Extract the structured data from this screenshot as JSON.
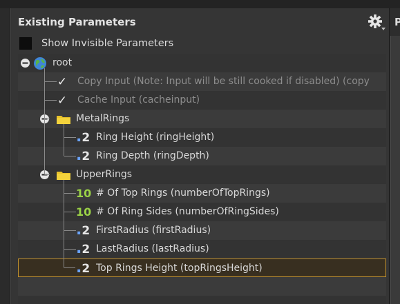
{
  "panel": {
    "title": "Existing Parameters",
    "gear_icon": "gear-menu-icon",
    "show_invisible": {
      "label": "Show Invisible Parameters",
      "checked": false
    }
  },
  "right_panel": {
    "title_fragment": "P"
  },
  "tree": {
    "root": {
      "label": "root",
      "icon": "globe-icon",
      "expanded": true
    },
    "items": [
      {
        "label": "Copy Input (Note: Input will be still cooked if disabled) (copy",
        "type": "toggle",
        "dimmed": true
      },
      {
        "label": "Cache Input (cacheinput)",
        "type": "toggle",
        "dimmed": true
      },
      {
        "label": "MetalRings",
        "type": "folder",
        "expanded": true
      },
      {
        "label": "Ring Height (ringHeight)",
        "type": "float"
      },
      {
        "label": "Ring Depth (ringDepth)",
        "type": "float"
      },
      {
        "label": "UpperRings",
        "type": "folder",
        "expanded": true
      },
      {
        "label": "# Of Top Rings (numberOfTopRings)",
        "type": "int",
        "glyph": "10"
      },
      {
        "label": "# Of Ring Sides (numberOfRingSides)",
        "type": "int",
        "glyph": "10"
      },
      {
        "label": "FirstRadius (firstRadius)",
        "type": "float"
      },
      {
        "label": "LastRadius (lastRadius)",
        "type": "float"
      },
      {
        "label": "Top Rings Height (topRingsHeight)",
        "type": "float",
        "selected": true
      }
    ],
    "float_glyph": ".2",
    "toggle_glyph": "✓"
  },
  "colors": {
    "selection_border": "#c2922f",
    "float_dot": "#6aa3ff",
    "int_glyph": "#9bd247",
    "folder": "#e8c22a"
  }
}
